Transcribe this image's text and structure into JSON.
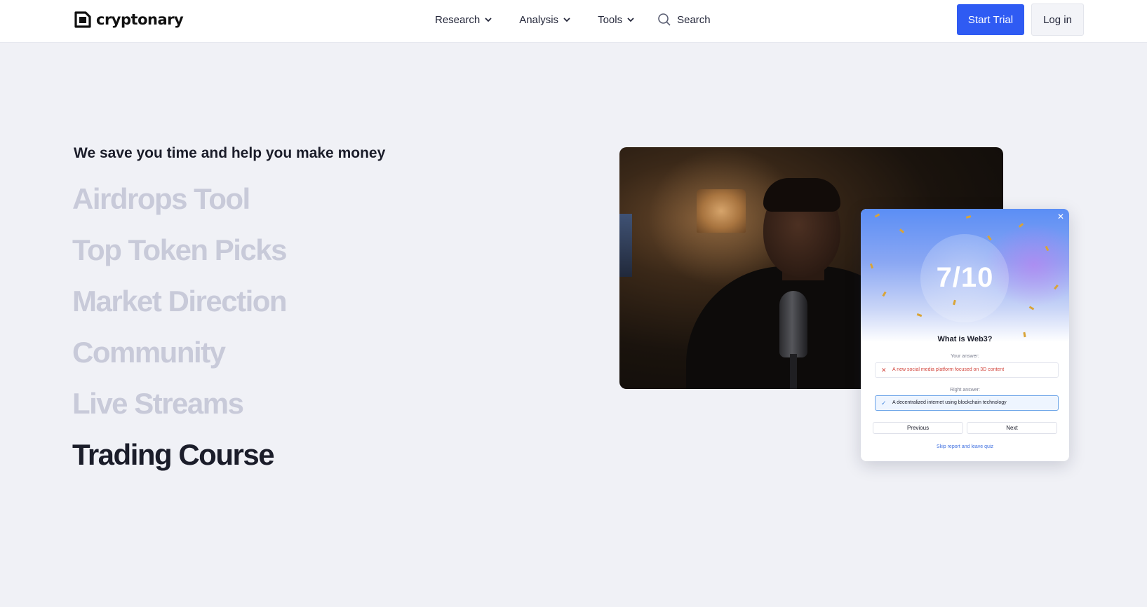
{
  "header": {
    "logo_text": "cryptonary",
    "nav": [
      {
        "label": "Research"
      },
      {
        "label": "Analysis"
      },
      {
        "label": "Tools"
      }
    ],
    "search_label": "Search",
    "start_trial": "Start Trial",
    "login": "Log in",
    "accent_color": "#2f5bf3"
  },
  "hero": {
    "tagline": "We save you time and help you make money",
    "features": [
      {
        "label": "Airdrops Tool",
        "active": false
      },
      {
        "label": "Top Token Picks",
        "active": false
      },
      {
        "label": "Market Direction",
        "active": false
      },
      {
        "label": "Community",
        "active": false
      },
      {
        "label": "Live Streams",
        "active": false
      },
      {
        "label": "Trading Course",
        "active": true
      }
    ]
  },
  "quiz": {
    "score": "7/10",
    "question": "What is Web3?",
    "your_answer_label": "Your answer:",
    "your_answer": "A new social media platform focused on 3D content",
    "right_answer_label": "Right answer:",
    "right_answer": "A decentralized internet using blockchain technology",
    "previous": "Previous",
    "next": "Next",
    "skip": "Skip report and leave quiz"
  }
}
